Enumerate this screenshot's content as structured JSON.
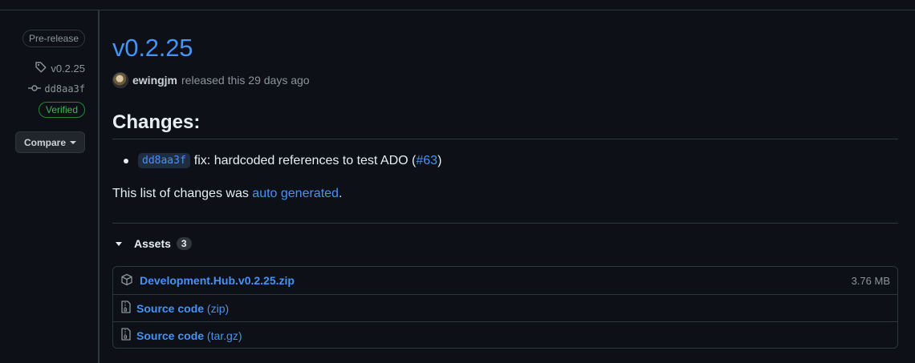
{
  "sidebar": {
    "pre_release_label": "Pre-release",
    "tag": "v0.2.25",
    "commit": "dd8aa3f",
    "verified_label": "Verified",
    "compare_label": "Compare"
  },
  "release": {
    "title": "v0.2.25",
    "author": "ewingjm",
    "released_text": "released this 29 days ago"
  },
  "changes": {
    "heading": "Changes:",
    "items": [
      {
        "sha": "dd8aa3f",
        "text": "fix: hardcoded references to test ADO (",
        "pr": "#63",
        "close": ")"
      }
    ],
    "footer_prefix": "This list of changes was ",
    "footer_link": "auto generated",
    "footer_suffix": "."
  },
  "assets": {
    "label": "Assets",
    "count": "3",
    "items": [
      {
        "name": "Development.Hub.v0.2.25.zip",
        "suffix": "",
        "size": "3.76 MB",
        "icon": "package-icon"
      },
      {
        "name": "Source code",
        "suffix": "(zip)",
        "size": "",
        "icon": "file-zip-icon"
      },
      {
        "name": "Source code",
        "suffix": "(tar.gz)",
        "size": "",
        "icon": "file-zip-icon"
      }
    ]
  },
  "colors": {
    "background": "#0d1117",
    "border": "#30363d",
    "link": "#4493f8",
    "muted": "#8b949e",
    "verified": "#3fb950"
  }
}
